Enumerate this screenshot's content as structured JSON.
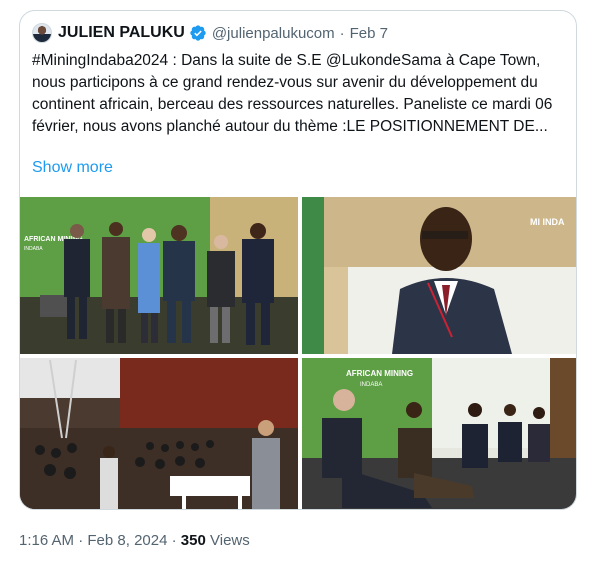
{
  "tweet": {
    "author_name": "JULIEN PALUKU",
    "handle": "@julienpalukucom",
    "separator": "·",
    "date": "Feb 7",
    "text": "#MiningIndaba2024 : Dans la suite de S.E @LukondeSama à Cape Town, nous participons à ce grand rendez-vous sur avenir du développement du continent africain, berceau des ressources naturelles. Paneliste ce mardi 06 février, nous avons planché autour du thème :LE POSITIONNEMENT DE...",
    "show_more_label": "Show more",
    "media": {
      "photo1_logo": "AFRICAN MINING",
      "photo1_sublogo": "INDABA",
      "photo2_banner": "MI INDA",
      "photo4_logo": "AFRICAN MINING",
      "photo4_sublogo": "INDABA"
    }
  },
  "footer": {
    "time": "1:16 AM",
    "separator": "·",
    "full_date": "Feb 8, 2024",
    "views_count": "350",
    "views_label": "Views"
  },
  "colors": {
    "link": "#1d9bf0",
    "muted": "#536471",
    "border": "#cfd9de",
    "verified": "#1d9bf0"
  }
}
